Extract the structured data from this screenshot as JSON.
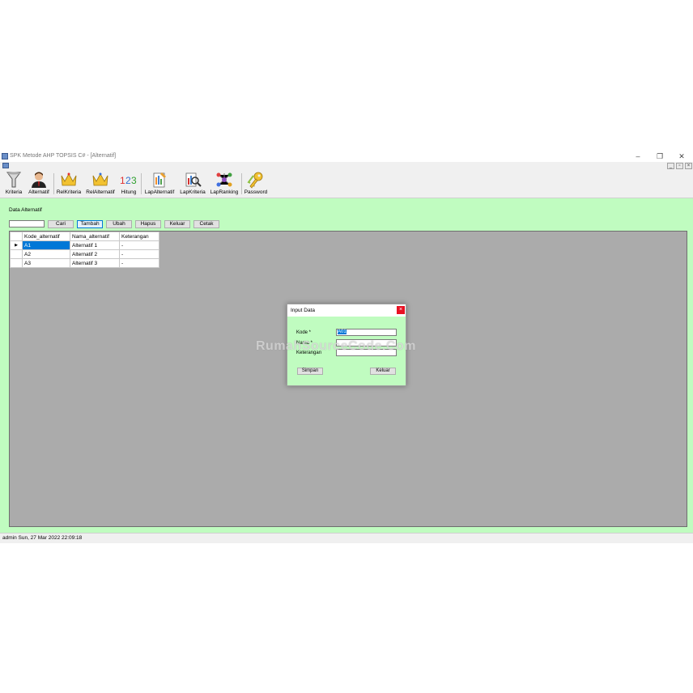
{
  "window": {
    "title": "SPK Metode AHP TOPSIS C# - [Alternatif]"
  },
  "toolbar": {
    "items": [
      {
        "label": "Kriteria",
        "icon": "funnel-icon"
      },
      {
        "label": "Alternatif",
        "icon": "user-icon"
      },
      {
        "label": "RelKriteria",
        "icon": "crown-icon"
      },
      {
        "label": "RelAlternatif",
        "icon": "crown-icon"
      },
      {
        "label": "Hitung",
        "icon": "numbers-icon"
      },
      {
        "label": "LapAlternatif",
        "icon": "report-icon"
      },
      {
        "label": "LapKriteria",
        "icon": "report-search-icon"
      },
      {
        "label": "LapRanking",
        "icon": "network-icon"
      },
      {
        "label": "Password",
        "icon": "keys-icon"
      }
    ]
  },
  "main": {
    "section_title": "Data Alternatif",
    "search_value": "",
    "buttons": [
      "Cari",
      "Tambah",
      "Ubah",
      "Hapus",
      "Keluar",
      "Cetak"
    ],
    "grid": {
      "columns": [
        "Kode_alternatif",
        "Nama_alternatif",
        "Keterangan"
      ],
      "rows": [
        [
          "A1",
          "Alternatif 1",
          "-"
        ],
        [
          "A2",
          "Alternatif 2",
          "-"
        ],
        [
          "A3",
          "Alternatif 3",
          "-"
        ]
      ]
    }
  },
  "dialog": {
    "title": "Input Data",
    "close": "×",
    "fields": [
      {
        "label": "Kode *",
        "value": "A01"
      },
      {
        "label": "Nama *",
        "value": ""
      },
      {
        "label": "Keterangan",
        "value": ""
      }
    ],
    "save": "Simpan",
    "cancel": "Keluar"
  },
  "status": "admin Sun, 27 Mar 2022 22:09:18",
  "watermark": "RumahSourceCode.Com",
  "colors": {
    "background": "#c0fcc0",
    "selection": "#0078d7",
    "grid_area": "#ababab"
  }
}
